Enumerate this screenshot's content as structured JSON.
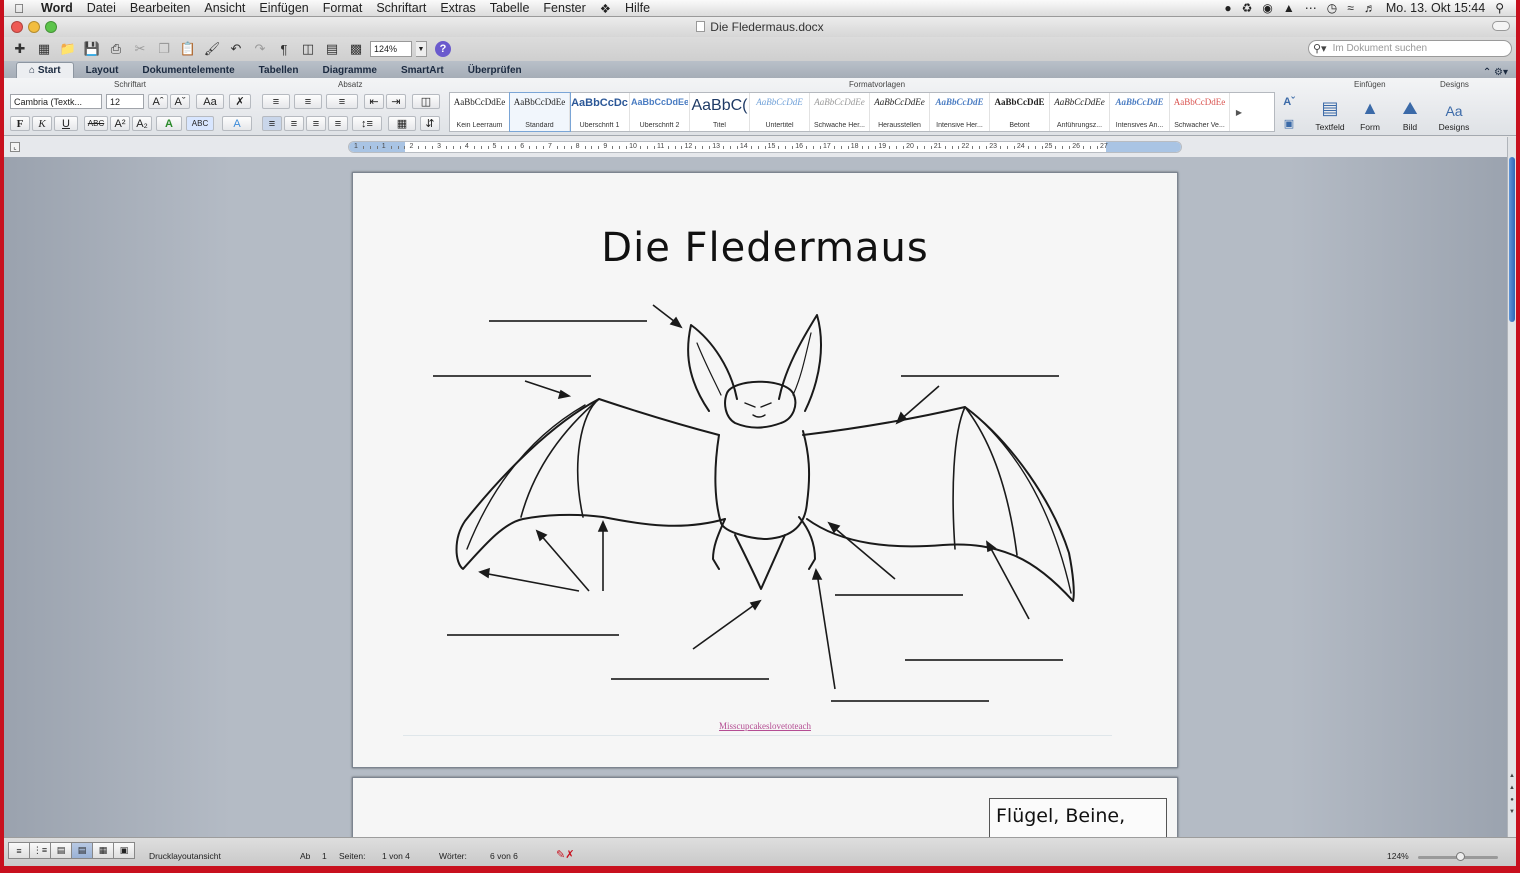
{
  "menubar": {
    "items": [
      "Word",
      "Datei",
      "Bearbeiten",
      "Ansicht",
      "Einfügen",
      "Format",
      "Schriftart",
      "Extras",
      "Tabelle",
      "Fenster",
      "Hilfe"
    ],
    "clock": "Mo. 13. Okt 15:44"
  },
  "window": {
    "title": "Die Fledermaus.docx"
  },
  "toolbar": {
    "zoom": "124%",
    "search_placeholder": "Im Dokument suchen"
  },
  "ribbon": {
    "tabs": [
      "Start",
      "Layout",
      "Dokumentelemente",
      "Tabellen",
      "Diagramme",
      "SmartArt",
      "Überprüfen"
    ],
    "groups": {
      "font": "Schriftart",
      "paragraph": "Absatz",
      "styles": "Formatvorlagen",
      "insert": "Einfügen",
      "themes": "Designs"
    },
    "font_name": "Cambria (Textk...",
    "font_size": "12",
    "styles": [
      {
        "sample": "AaBbCcDdEe",
        "name": "Kein Leerraum"
      },
      {
        "sample": "AaBbCcDdEe",
        "name": "Standard"
      },
      {
        "sample": "AaBbCcDc",
        "name": "Überschrift 1"
      },
      {
        "sample": "AaBbCcDdEe",
        "name": "Überschrift 2"
      },
      {
        "sample": "AaBbC(",
        "name": "Titel"
      },
      {
        "sample": "AaBbCcDdE",
        "name": "Untertitel"
      },
      {
        "sample": "AaBbCcDdEe",
        "name": "Schwache Her..."
      },
      {
        "sample": "AaBbCcDdEe",
        "name": "Herausstellen"
      },
      {
        "sample": "AaBbCcDdE",
        "name": "Intensive Her..."
      },
      {
        "sample": "AaBbCcDdE",
        "name": "Betont"
      },
      {
        "sample": "AaBbCcDdEe",
        "name": "Anführungsz..."
      },
      {
        "sample": "AaBbCcDdE",
        "name": "Intensives An..."
      },
      {
        "sample": "AaBbCcDdEe",
        "name": "Schwacher Ve..."
      }
    ],
    "insert_buttons": [
      "Textfeld",
      "Form",
      "Bild"
    ],
    "themes_button": "Designs"
  },
  "ruler": {
    "labels": [
      "1",
      "1",
      "2",
      "3",
      "4",
      "5",
      "6",
      "7",
      "8",
      "9",
      "10",
      "11",
      "12",
      "13",
      "14",
      "15",
      "16",
      "17",
      "18",
      "19",
      "20",
      "21",
      "22",
      "23",
      "24",
      "25",
      "26",
      "27"
    ]
  },
  "document": {
    "title": "Die Fledermaus",
    "credit": "Misscupcakeslovetoteach",
    "page2_textbox": "Flügel, Beine,"
  },
  "statusbar": {
    "view_label": "Drucklayoutansicht",
    "section_label": "Ab",
    "section_value": "1",
    "pages_label": "Seiten:",
    "pages_value": "1 von 4",
    "words_label": "Wörter:",
    "words_value": "6 von 6",
    "zoom": "124%"
  },
  "colors": {
    "accent": "#3b6aa8",
    "credit": "#b44d93",
    "scroll_thumb": "#2f67b5",
    "screen_border": "#c8101e"
  }
}
